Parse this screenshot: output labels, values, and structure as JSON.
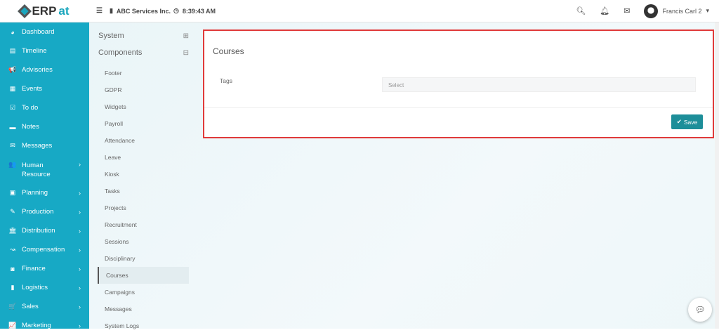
{
  "header": {
    "logo": "ERPat",
    "logo_main": "ERP",
    "logo_accent": "at",
    "company": "ABC Services Inc.",
    "time": "8:39:43 AM",
    "user": "Francis Carl 2"
  },
  "sidebar": {
    "items": [
      {
        "label": "Dashboard",
        "icon": "dashboard-icon",
        "glyph": "◕"
      },
      {
        "label": "Timeline",
        "icon": "timeline-icon",
        "glyph": "▤"
      },
      {
        "label": "Advisories",
        "icon": "megaphone-icon",
        "glyph": "📢"
      },
      {
        "label": "Events",
        "icon": "calendar-icon",
        "glyph": "▦"
      },
      {
        "label": "To do",
        "icon": "checkbox-icon",
        "glyph": "☑"
      },
      {
        "label": "Notes",
        "icon": "note-icon",
        "glyph": "▬"
      },
      {
        "label": "Messages",
        "icon": "envelope-icon",
        "glyph": "✉"
      },
      {
        "label": "Human Resource",
        "icon": "users-icon",
        "glyph": "👥",
        "sub": true
      },
      {
        "label": "Planning",
        "icon": "briefcase-icon",
        "glyph": "▣",
        "sub": true
      },
      {
        "label": "Production",
        "icon": "pen-icon",
        "glyph": "✎",
        "sub": true
      },
      {
        "label": "Distribution",
        "icon": "bank-icon",
        "glyph": "🏛",
        "sub": true
      },
      {
        "label": "Compensation",
        "icon": "money-icon",
        "glyph": "↝",
        "sub": true
      },
      {
        "label": "Finance",
        "icon": "cash-icon",
        "glyph": "◙",
        "sub": true
      },
      {
        "label": "Logistics",
        "icon": "truck-icon",
        "glyph": "▮",
        "sub": true
      },
      {
        "label": "Sales",
        "icon": "cart-icon",
        "glyph": "🛒",
        "sub": true
      },
      {
        "label": "Marketing",
        "icon": "chart-icon",
        "glyph": "📈",
        "sub": true
      }
    ]
  },
  "submenu": {
    "system": "System",
    "components": "Components",
    "items": [
      "Footer",
      "GDPR",
      "Widgets",
      "Payroll",
      "Attendance",
      "Leave",
      "Kiosk",
      "Tasks",
      "Projects",
      "Recruitment",
      "Sessions",
      "Disciplinary",
      "Courses",
      "Campaigns",
      "Messages",
      "System Logs"
    ],
    "active": "Courses"
  },
  "card": {
    "title": "Courses",
    "tags_label": "Tags",
    "tags_placeholder": "Select",
    "save": "Save"
  }
}
